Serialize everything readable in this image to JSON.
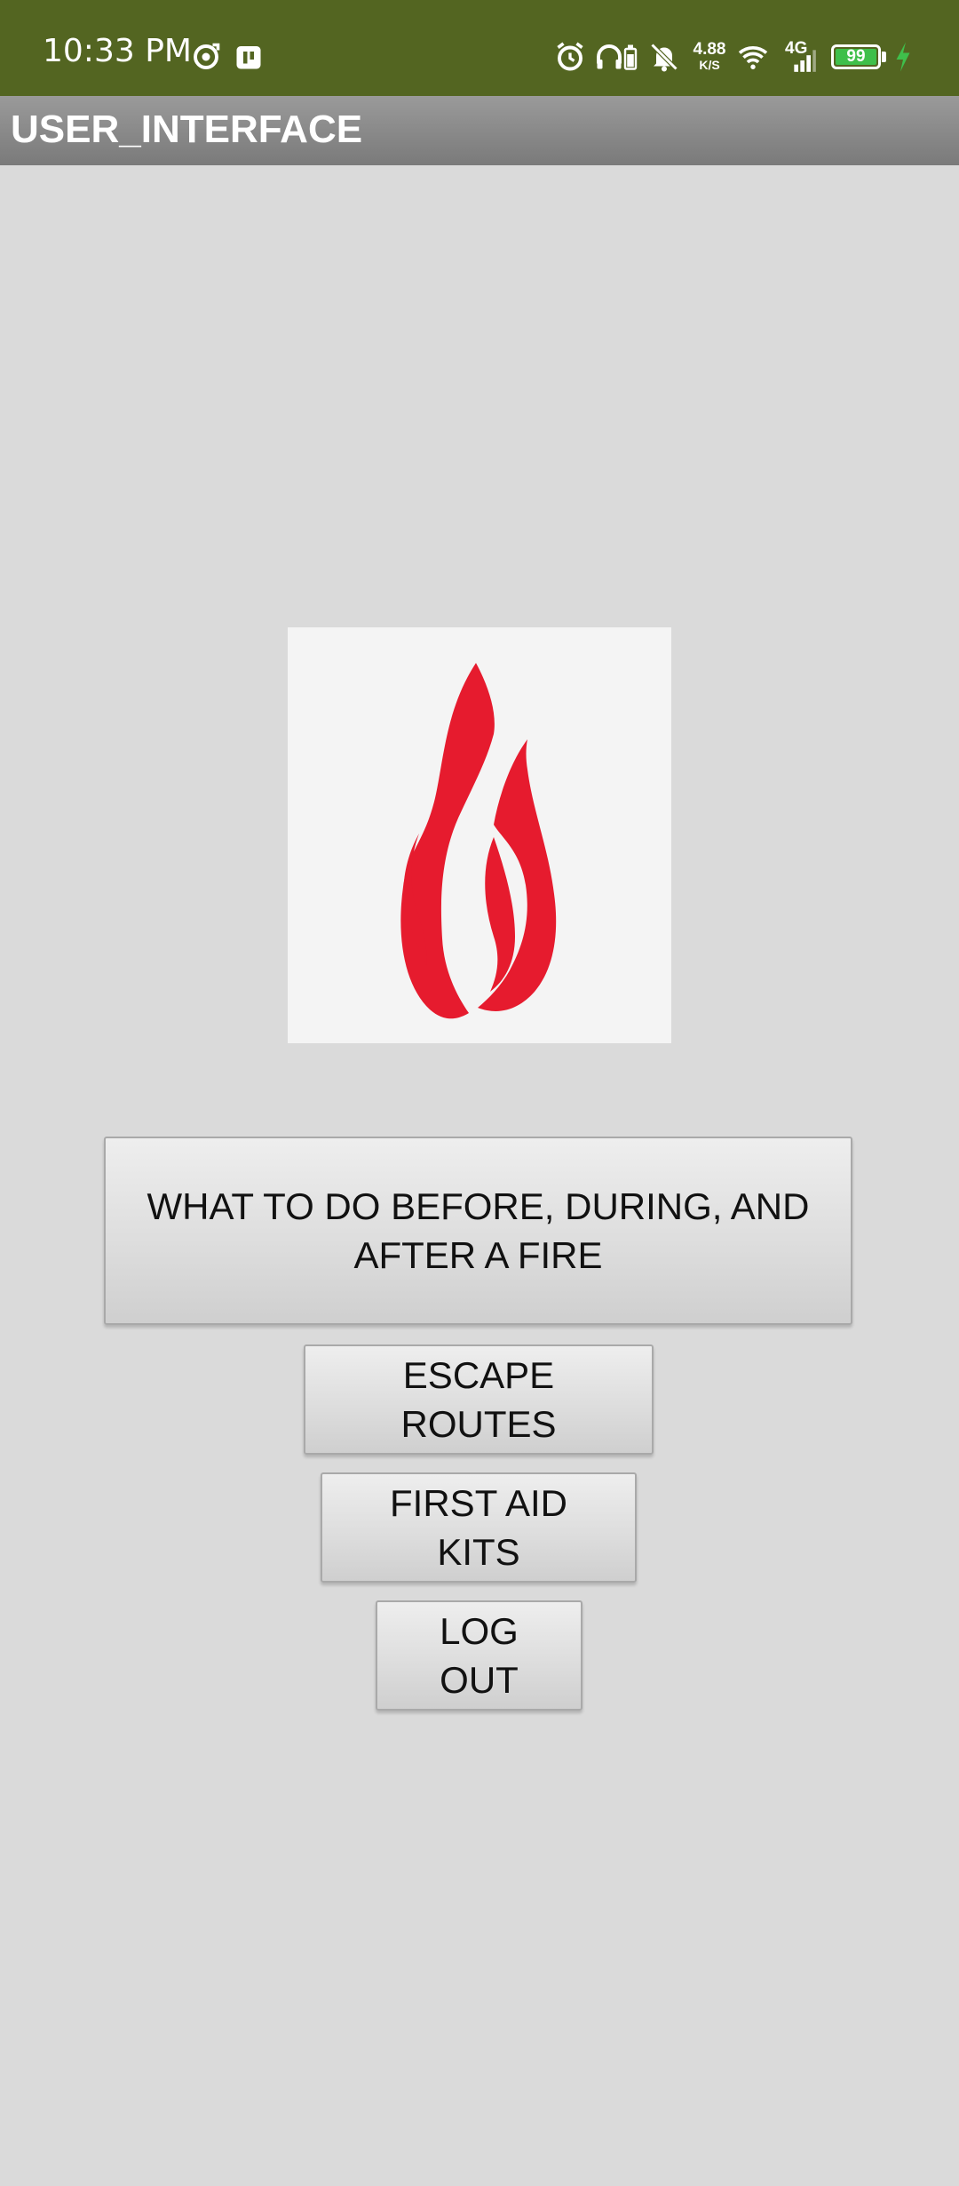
{
  "status_bar": {
    "time": "10:33 PM",
    "net_speed_value": "4.88",
    "net_speed_unit": "K/S",
    "network_type": "4G",
    "battery_level": "99",
    "background_color": "#536521",
    "battery_color": "#3fbf4b",
    "icons": [
      "sync-icon",
      "app-notification-icon",
      "alarm-icon",
      "headphones-icon",
      "headphone-battery-icon",
      "notifications-muted-icon",
      "wifi-icon",
      "signal-icon",
      "charging-icon"
    ]
  },
  "app_bar": {
    "title": "USER_INTERFACE",
    "background_color": "#8a8a8a"
  },
  "main": {
    "logo": {
      "icon": "fire-flame-icon",
      "color": "#e61b2e"
    },
    "buttons": [
      {
        "label": "WHAT TO DO BEFORE, DURING, AND AFTER A FIRE"
      },
      {
        "label": "ESCAPE ROUTES"
      },
      {
        "label": "FIRST AID KITS"
      },
      {
        "label": "LOG OUT"
      }
    ]
  }
}
